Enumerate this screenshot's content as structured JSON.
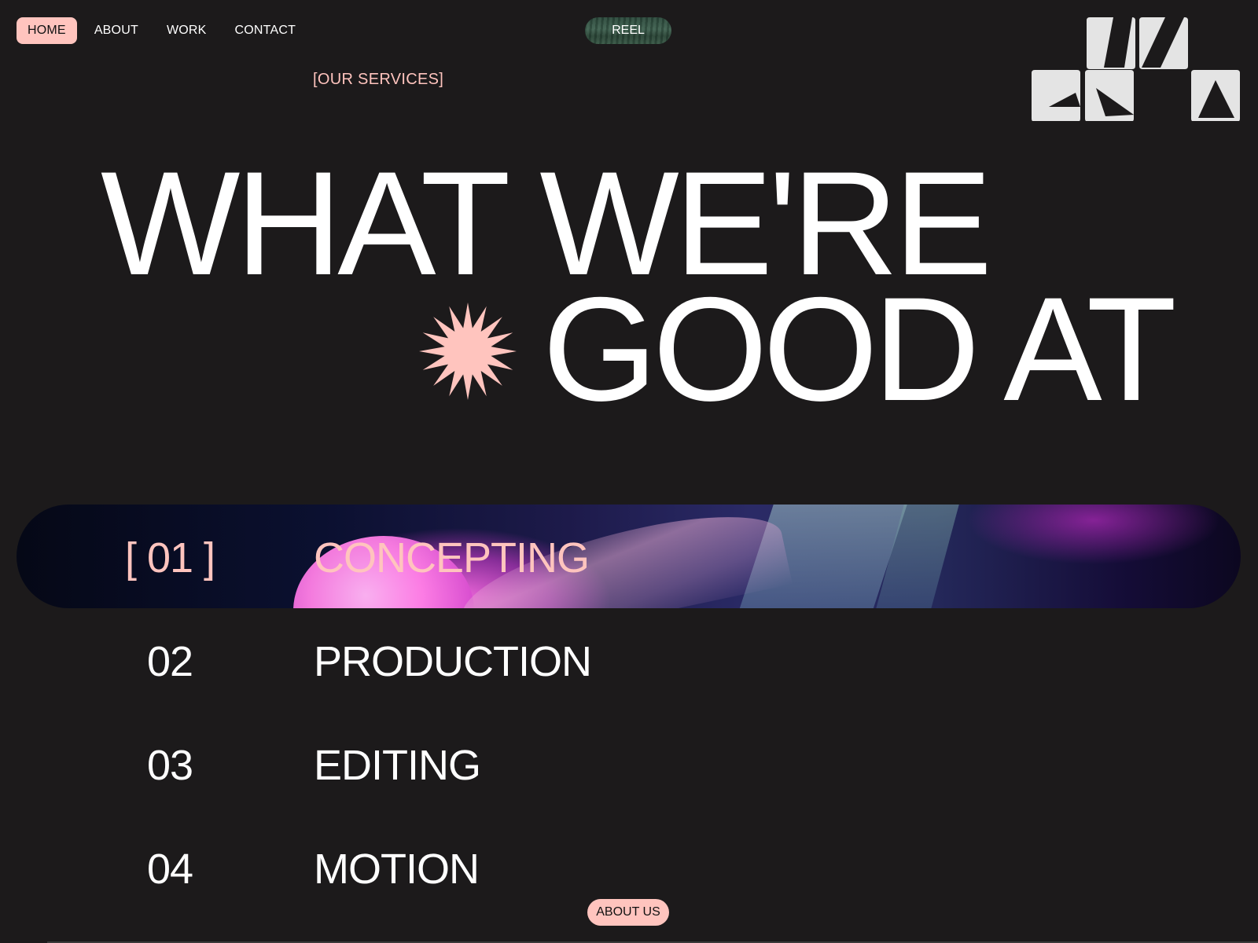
{
  "nav": {
    "items": [
      {
        "label": "HOME",
        "active": true
      },
      {
        "label": "ABOUT",
        "active": false
      },
      {
        "label": "WORK",
        "active": false
      },
      {
        "label": "CONTACT",
        "active": false
      }
    ],
    "reel_label": "REEL"
  },
  "hero": {
    "eyebrow": "[OUR SERVICES]",
    "line1": "WHAT WE'RE",
    "line2": "GOOD AT"
  },
  "services": [
    {
      "num": "[ 01 ]",
      "title": "CONCEPTING",
      "active": true
    },
    {
      "num": "02",
      "title": "PRODUCTION",
      "active": false
    },
    {
      "num": "03",
      "title": "EDITING",
      "active": false
    },
    {
      "num": "04",
      "title": "MOTION",
      "active": false
    }
  ],
  "about_button": "ABOUT US",
  "colors": {
    "background": "#1c1a1b",
    "accent": "#ffc4be",
    "text": "#ffffff",
    "logo": "#e4e4e4"
  },
  "icons": {
    "logo": "brand-logo-icon",
    "decor": "starburst-icon"
  }
}
